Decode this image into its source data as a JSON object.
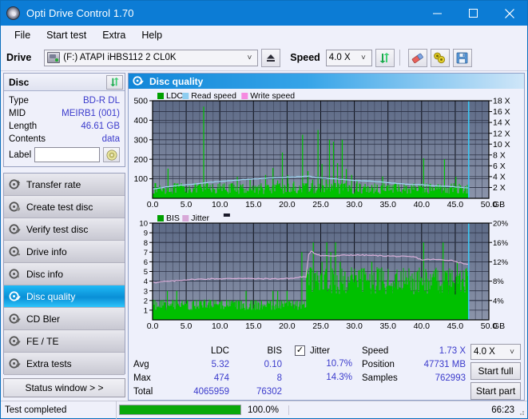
{
  "window": {
    "title": "Opti Drive Control 1.70",
    "icon": "disc-icon",
    "minimize": "minimize-icon",
    "maximize": "maximize-icon",
    "close": "close-icon"
  },
  "menu": {
    "items": [
      "File",
      "Start test",
      "Extra",
      "Help"
    ]
  },
  "toolbar": {
    "drive_label": "Drive",
    "drive_value": "(F:)   ATAPI iHBS112  2 CL0K",
    "eject_icon": "eject-icon",
    "speed_label": "Speed",
    "speed_value": "4.0 X",
    "refresh_icon": "refresh-icon",
    "eraser_icon": "eraser-icon",
    "tag_icon": "tag-icon",
    "save_icon": "save-icon"
  },
  "disc_panel": {
    "title": "Disc",
    "refresh_icon": "refresh-icon",
    "rows": [
      {
        "key": "Type",
        "value": "BD-R DL"
      },
      {
        "key": "MID",
        "value": "MEIRB1 (001)"
      },
      {
        "key": "Length",
        "value": "46.61 GB"
      },
      {
        "key": "Contents",
        "value": "data"
      }
    ],
    "label_key": "Label",
    "label_value": "",
    "label_placeholder": "",
    "label_button_icon": "disc-icon"
  },
  "nav": {
    "items": [
      {
        "label": "Transfer rate",
        "icon": "disc-transfer-icon",
        "selected": false
      },
      {
        "label": "Create test disc",
        "icon": "disc-create-icon",
        "selected": false
      },
      {
        "label": "Verify test disc",
        "icon": "disc-verify-icon",
        "selected": false
      },
      {
        "label": "Drive info",
        "icon": "disc-drive-icon",
        "selected": false
      },
      {
        "label": "Disc info",
        "icon": "disc-info-icon",
        "selected": false
      },
      {
        "label": "Disc quality",
        "icon": "disc-quality-icon",
        "selected": true
      },
      {
        "label": "CD Bler",
        "icon": "disc-bler-icon",
        "selected": false
      },
      {
        "label": "FE / TE",
        "icon": "disc-fete-icon",
        "selected": false
      },
      {
        "label": "Extra tests",
        "icon": "disc-extra-icon",
        "selected": false
      }
    ],
    "status_window": "Status window > >"
  },
  "content": {
    "header_title": "Disc quality",
    "header_icon": "disc-quality-icon"
  },
  "stats": {
    "col_headers": [
      "LDC",
      "BIS"
    ],
    "row_labels": [
      "Avg",
      "Max",
      "Total"
    ],
    "ldc": {
      "avg": "5.32",
      "max": "474",
      "total": "4065959"
    },
    "bis": {
      "avg": "0.10",
      "max": "8",
      "total": "76302"
    },
    "jitter": {
      "label": "Jitter",
      "checked": true,
      "avg": "10.7%",
      "max": "14.3%"
    },
    "speed_label": "Speed",
    "speed_value": "1.73 X",
    "position_label": "Position",
    "position_value": "47731 MB",
    "samples_label": "Samples",
    "samples_value": "762993",
    "speed_select": "4.0 X",
    "start_full": "Start full",
    "start_part": "Start part"
  },
  "statusbar": {
    "text": "Test completed",
    "progress_pct": "100.0%",
    "progress_value": 100,
    "elapsed": "66:23"
  },
  "chart_data": [
    {
      "type": "line",
      "name": "ldc-chart",
      "title": "",
      "xlabel": "GB",
      "ylabel": "",
      "legend": [
        {
          "label": "LDC",
          "color": "#00a000"
        },
        {
          "label": "Read speed",
          "color": "#8ecdf0"
        },
        {
          "label": "Write speed",
          "color": "#f58ae0"
        }
      ],
      "legend_position": "top-left",
      "grid": true,
      "xlim": [
        0,
        50
      ],
      "xticks": [
        "0.0",
        "5.0",
        "10.0",
        "15.0",
        "20.0",
        "25.0",
        "30.0",
        "35.0",
        "40.0",
        "45.0",
        "50.0"
      ],
      "xtick_suffix": "GB",
      "ylim": [
        0,
        500
      ],
      "yticks": [
        100,
        200,
        300,
        400,
        500
      ],
      "y2label": "X",
      "y2lim": [
        0,
        18
      ],
      "y2ticks": [
        "2 X",
        "4 X",
        "6 X",
        "8 X",
        "10 X",
        "12 X",
        "14 X",
        "16 X",
        "18 X"
      ],
      "data_end_gb": 47.0,
      "series": [
        {
          "name": "LDC",
          "color": "#00c000",
          "kind": "spikes",
          "baseline": 22,
          "peaks": [
            [
              2.3,
              152
            ],
            [
              3.1,
              60
            ],
            [
              4.2,
              55
            ],
            [
              5.6,
              48
            ],
            [
              6.4,
              66
            ],
            [
              7.6,
              470
            ],
            [
              8.1,
              78
            ],
            [
              9.0,
              52
            ],
            [
              10.2,
              62
            ],
            [
              11.4,
              58
            ],
            [
              12.6,
              110
            ],
            [
              13.4,
              70
            ],
            [
              14.5,
              96
            ],
            [
              15.6,
              60
            ],
            [
              16.8,
              120
            ],
            [
              17.9,
              155
            ],
            [
              18.6,
              92
            ],
            [
              19.3,
              235
            ],
            [
              20.1,
              120
            ],
            [
              21.0,
              86
            ],
            [
              22.3,
              326
            ],
            [
              23.1,
              140
            ],
            [
              23.8,
              96
            ],
            [
              24.6,
              350
            ],
            [
              25.2,
              176
            ],
            [
              25.8,
              96
            ],
            [
              26.3,
              300
            ],
            [
              26.9,
              290
            ],
            [
              27.5,
              180
            ],
            [
              28.2,
              300
            ],
            [
              28.8,
              150
            ],
            [
              29.6,
              120
            ],
            [
              30.4,
              95
            ],
            [
              31.6,
              74
            ],
            [
              32.6,
              68
            ],
            [
              33.4,
              70
            ],
            [
              34.2,
              112
            ],
            [
              34.9,
              62
            ],
            [
              36.2,
              58
            ],
            [
              37.4,
              52
            ],
            [
              38.6,
              60
            ],
            [
              39.6,
              66
            ],
            [
              40.3,
              205
            ],
            [
              41.2,
              72
            ],
            [
              42.1,
              60
            ],
            [
              43.4,
              200
            ],
            [
              44.2,
              58
            ],
            [
              45.1,
              110
            ],
            [
              45.8,
              66
            ],
            [
              46.5,
              62
            ]
          ]
        },
        {
          "name": "Read speed",
          "color": "#9fd8f5",
          "kind": "line",
          "axis": "y2",
          "points": [
            [
              0.1,
              1.7
            ],
            [
              2.0,
              2.1
            ],
            [
              4.0,
              2.4
            ],
            [
              6.0,
              2.6
            ],
            [
              8.0,
              2.9
            ],
            [
              10.0,
              3.1
            ],
            [
              12.0,
              3.3
            ],
            [
              14.0,
              3.5
            ],
            [
              16.0,
              3.6
            ],
            [
              18.0,
              3.8
            ],
            [
              20.0,
              3.9
            ],
            [
              22.0,
              4.0
            ],
            [
              23.2,
              4.1
            ],
            [
              24.0,
              3.9
            ],
            [
              26.0,
              3.7
            ],
            [
              28.0,
              3.5
            ],
            [
              30.0,
              3.3
            ],
            [
              32.0,
              3.2
            ],
            [
              34.0,
              3.0
            ],
            [
              36.0,
              2.8
            ],
            [
              38.0,
              2.6
            ],
            [
              40.0,
              2.5
            ],
            [
              42.0,
              2.3
            ],
            [
              44.0,
              2.2
            ],
            [
              46.0,
              2.0
            ],
            [
              47.0,
              1.9
            ]
          ]
        }
      ],
      "end_marker": {
        "x": 47.0,
        "color": "#3ac8f5"
      }
    },
    {
      "type": "line",
      "name": "bis-jitter-chart",
      "title": "",
      "xlabel": "GB",
      "ylabel": "",
      "legend": [
        {
          "label": "BIS",
          "color": "#00a000"
        },
        {
          "label": "Jitter",
          "color": "#d8a8d8"
        }
      ],
      "legend_position": "top-left",
      "grid": true,
      "xlim": [
        0,
        50
      ],
      "xticks": [
        "0.0",
        "5.0",
        "10.0",
        "15.0",
        "20.0",
        "25.0",
        "30.0",
        "35.0",
        "40.0",
        "45.0",
        "50.0"
      ],
      "xtick_suffix": "GB",
      "ylim": [
        0,
        10
      ],
      "yticks": [
        1,
        2,
        3,
        4,
        5,
        6,
        7,
        8,
        9,
        10
      ],
      "y2label": "%",
      "y2lim": [
        0,
        20
      ],
      "y2ticks": [
        "4%",
        "8%",
        "12%",
        "16%",
        "20%"
      ],
      "data_end_gb": 47.0,
      "series": [
        {
          "name": "BIS",
          "color": "#00c000",
          "kind": "spikes",
          "baseline": 1.0,
          "baseline2_from": 23.0,
          "baseline2": 2.6,
          "peaks": [
            [
              1.2,
              2
            ],
            [
              2.2,
              3
            ],
            [
              3.0,
              2
            ],
            [
              3.6,
              3
            ],
            [
              4.4,
              2
            ],
            [
              5.2,
              2
            ],
            [
              6.1,
              2
            ],
            [
              7.0,
              2
            ],
            [
              7.8,
              2
            ],
            [
              8.6,
              2
            ],
            [
              9.4,
              2
            ],
            [
              10.3,
              2
            ],
            [
              11.0,
              2
            ],
            [
              11.8,
              2
            ],
            [
              12.4,
              2
            ],
            [
              13.2,
              2
            ],
            [
              13.9,
              3
            ],
            [
              14.6,
              2
            ],
            [
              15.4,
              2
            ],
            [
              16.2,
              2
            ],
            [
              17.1,
              2
            ],
            [
              17.9,
              3
            ],
            [
              18.6,
              3
            ],
            [
              19.2,
              2
            ],
            [
              20.0,
              3
            ],
            [
              20.8,
              2
            ],
            [
              21.5,
              2
            ],
            [
              22.2,
              7
            ],
            [
              22.9,
              5
            ],
            [
              23.4,
              5
            ],
            [
              23.9,
              8
            ],
            [
              24.4,
              3
            ],
            [
              25.2,
              6
            ],
            [
              25.9,
              8
            ],
            [
              26.5,
              7
            ],
            [
              27.2,
              8
            ],
            [
              27.9,
              6
            ],
            [
              28.6,
              5
            ],
            [
              29.4,
              4
            ],
            [
              30.2,
              4
            ],
            [
              31.0,
              4
            ],
            [
              31.8,
              4
            ],
            [
              32.6,
              6
            ],
            [
              33.4,
              4
            ],
            [
              34.2,
              4
            ],
            [
              35.0,
              4
            ],
            [
              35.8,
              4
            ],
            [
              36.6,
              4
            ],
            [
              37.4,
              4
            ],
            [
              38.2,
              4
            ],
            [
              39.0,
              4
            ],
            [
              39.8,
              4
            ],
            [
              40.3,
              8
            ],
            [
              41.1,
              4
            ],
            [
              41.9,
              4
            ],
            [
              42.6,
              4
            ],
            [
              43.2,
              8
            ],
            [
              43.9,
              4
            ],
            [
              44.6,
              4
            ],
            [
              45.3,
              6
            ],
            [
              46.0,
              4
            ],
            [
              46.6,
              4
            ]
          ]
        },
        {
          "name": "Jitter",
          "color": "#d9afd9",
          "kind": "line",
          "axis": "y2",
          "points": [
            [
              0.1,
              7.9
            ],
            [
              0.5,
              7.7
            ],
            [
              1.5,
              7.9
            ],
            [
              3.0,
              8.0
            ],
            [
              5.0,
              8.3
            ],
            [
              7.0,
              8.4
            ],
            [
              9.0,
              8.5
            ],
            [
              11.0,
              8.5
            ],
            [
              13.0,
              8.6
            ],
            [
              15.0,
              8.5
            ],
            [
              17.0,
              8.5
            ],
            [
              19.0,
              8.5
            ],
            [
              21.0,
              8.6
            ],
            [
              22.2,
              8.9
            ],
            [
              22.8,
              8.8
            ],
            [
              23.2,
              13.4
            ],
            [
              23.6,
              14.3
            ],
            [
              24.0,
              13.8
            ],
            [
              25.0,
              13.3
            ],
            [
              27.0,
              13.2
            ],
            [
              29.0,
              13.4
            ],
            [
              31.0,
              13.4
            ],
            [
              33.0,
              13.3
            ],
            [
              35.0,
              13.2
            ],
            [
              37.0,
              13.1
            ],
            [
              39.0,
              13.0
            ],
            [
              40.0,
              12.4
            ],
            [
              41.5,
              12.5
            ],
            [
              43.0,
              12.4
            ],
            [
              44.5,
              12.3
            ],
            [
              45.5,
              11.9
            ],
            [
              46.5,
              11.6
            ],
            [
              47.0,
              11.5
            ]
          ]
        }
      ],
      "end_marker": {
        "x": 47.0,
        "color": "#3ac8f5"
      }
    }
  ]
}
